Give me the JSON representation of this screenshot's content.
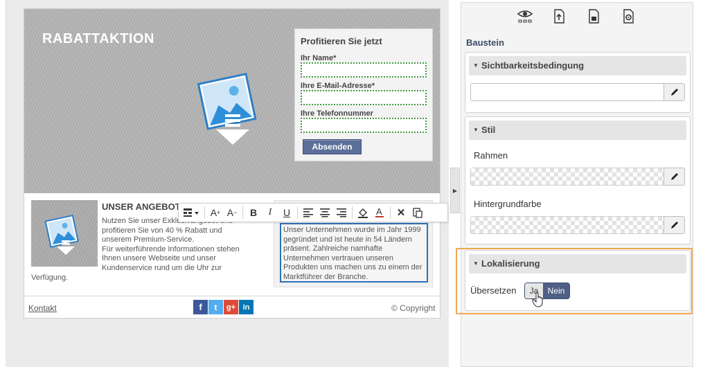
{
  "hero": {
    "title": "RABATTAKTION"
  },
  "form": {
    "title": "Profitieren Sie jetzt",
    "fields": [
      {
        "label": "Ihr Name*"
      },
      {
        "label": "Ihre E-Mail-Adresse*"
      },
      {
        "label": "Ihre Telefonnummer"
      }
    ],
    "submit_label": "Absenden"
  },
  "offer": {
    "title": "UNSER ANGEBOT",
    "text": "Nutzen Sie unser Exklusivangebot und\nprofitieren Sie von 40 % Rabatt und\nunserem Premium-Service.\nFür weiterführende Informationen stehen\nIhnen unsere Webseite und unser\nKundenservice rund um die Uhr zur",
    "text_tail": "Verfügung."
  },
  "right_column": {
    "text": "Unser Unternehmen wurde im Jahr 1999 gegründet und ist heute in 54 Ländern präsent. Zahlreiche namhafte Unternehmen vertrauen unseren Produkten uns machen uns zu einem der Marktführer der Branche."
  },
  "toolbar": {
    "buttons": [
      {
        "name": "insert-block-icon",
        "glyph": "▤▾"
      },
      {
        "name": "font-grow-icon",
        "glyph": "A⁺"
      },
      {
        "name": "font-shrink-icon",
        "glyph": "A⁻"
      },
      {
        "name": "bold-icon",
        "glyph": "B"
      },
      {
        "name": "italic-icon",
        "glyph": "I"
      },
      {
        "name": "underline-icon",
        "glyph": "U"
      },
      {
        "name": "align-left-icon",
        "glyph": "≡"
      },
      {
        "name": "align-center-icon",
        "glyph": "≡"
      },
      {
        "name": "align-right-icon",
        "glyph": "≡"
      },
      {
        "name": "fill-color-icon",
        "glyph": "◈"
      },
      {
        "name": "font-color-icon",
        "glyph": "A"
      },
      {
        "name": "remove-format-icon",
        "glyph": "✕"
      },
      {
        "name": "paste-icon",
        "glyph": "⎘"
      }
    ]
  },
  "footer": {
    "link": "Kontakt",
    "copyright": "© Copyright",
    "social": [
      {
        "name": "facebook-icon",
        "glyph": "f",
        "color": "#3b5998"
      },
      {
        "name": "twitter-icon",
        "glyph": "t",
        "color": "#55acee"
      },
      {
        "name": "google-plus-icon",
        "glyph": "g+",
        "color": "#dd4b39"
      },
      {
        "name": "linkedin-icon",
        "glyph": "in",
        "color": "#0077b5"
      }
    ]
  },
  "panel": {
    "icons": [
      "preview-icon",
      "export-page-icon",
      "save-page-icon",
      "page-settings-icon"
    ],
    "heading": "Baustein",
    "visibility": {
      "title": "Sichtbarkeitsbedingung",
      "value": ""
    },
    "style": {
      "title": "Stil",
      "border_label": "Rahmen",
      "background_label": "Hintergrundfarbe"
    },
    "localization": {
      "title": "Lokalisierung",
      "translate_label": "Übersetzen",
      "yes_label": "Ja",
      "no_label": "Nein",
      "selected": "Nein"
    }
  },
  "colors": {
    "accent": "#4f5f86",
    "highlight": "#f2a750",
    "edit_border": "#2d6fb8",
    "field_border": "#3c9a3c"
  }
}
